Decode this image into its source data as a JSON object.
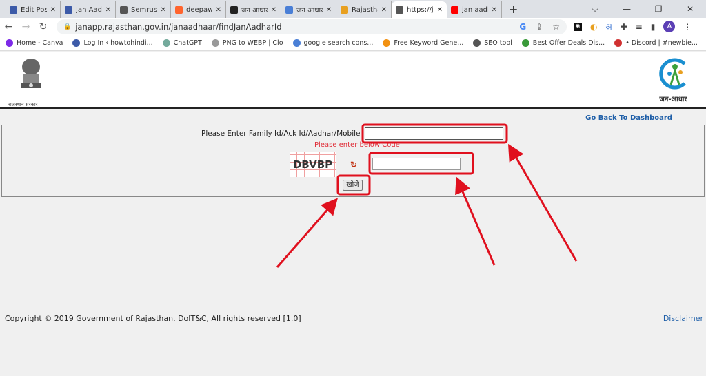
{
  "browser": {
    "tabs": [
      {
        "label": "Edit Post",
        "icon": "h-icon",
        "color": "#3c5aa8"
      },
      {
        "label": "Jan Aadhar",
        "icon": "h-icon",
        "color": "#3c5aa8"
      },
      {
        "label": "Semrush -",
        "icon": "globe-icon",
        "color": "#555555"
      },
      {
        "label": "deepawali",
        "icon": "semrush-icon",
        "color": "#ff642d"
      },
      {
        "label": "जन आधार",
        "icon": "dark-icon",
        "color": "#222222"
      },
      {
        "label": "जन आधार",
        "icon": "c-icon",
        "color": "#4a7fd6"
      },
      {
        "label": "Rajasthan",
        "icon": "lamp-icon",
        "color": "#e8a020"
      },
      {
        "label": "https://jan",
        "icon": "globe-icon",
        "color": "#555555",
        "active": true
      },
      {
        "label": "jan aadhar",
        "icon": "youtube-icon",
        "color": "#ff0000"
      }
    ],
    "url": "janapp.rajasthan.gov.in/janaadhaar/findJanAadharId",
    "avatar": "A",
    "bookmarks": [
      {
        "label": "Home - Canva",
        "color": "#7d2ae8"
      },
      {
        "label": "Log In ‹ howtohindi...",
        "color": "#3c5aa8"
      },
      {
        "label": "ChatGPT",
        "color": "#74aa9c"
      },
      {
        "label": "PNG to WEBP | Clo",
        "color": "#999999"
      },
      {
        "label": "google search cons...",
        "color": "#4a7fd6"
      },
      {
        "label": "Free Keyword Gene...",
        "color": "#f29111"
      },
      {
        "label": "SEO tool",
        "color": "#555555"
      },
      {
        "label": "Best Offer Deals Dis...",
        "color": "#3a9a3a"
      },
      {
        "label": "• Discord | #newbie...",
        "color": "#d03030"
      }
    ]
  },
  "header": {
    "gov_text": "राजस्थान सरकार",
    "emblem_text": "सत्यमेव जयते",
    "logo_text": "जन-आधार"
  },
  "page": {
    "back_link": "Go Back To Dashboard",
    "id_label": "Please Enter Family Id/Ack Id/Aadhar/Mobile",
    "id_value": "",
    "captcha_prompt": "Please enter below Code",
    "captcha_text": "DBVBP",
    "captcha_value": "",
    "search_button": "खोजे"
  },
  "footer": {
    "copyright": "Copyright © 2019 Government of Rajasthan. DoIT&C, All rights reserved [1.0]",
    "disclaimer": "Disclaimer"
  },
  "annotation_color": "#e0101e"
}
